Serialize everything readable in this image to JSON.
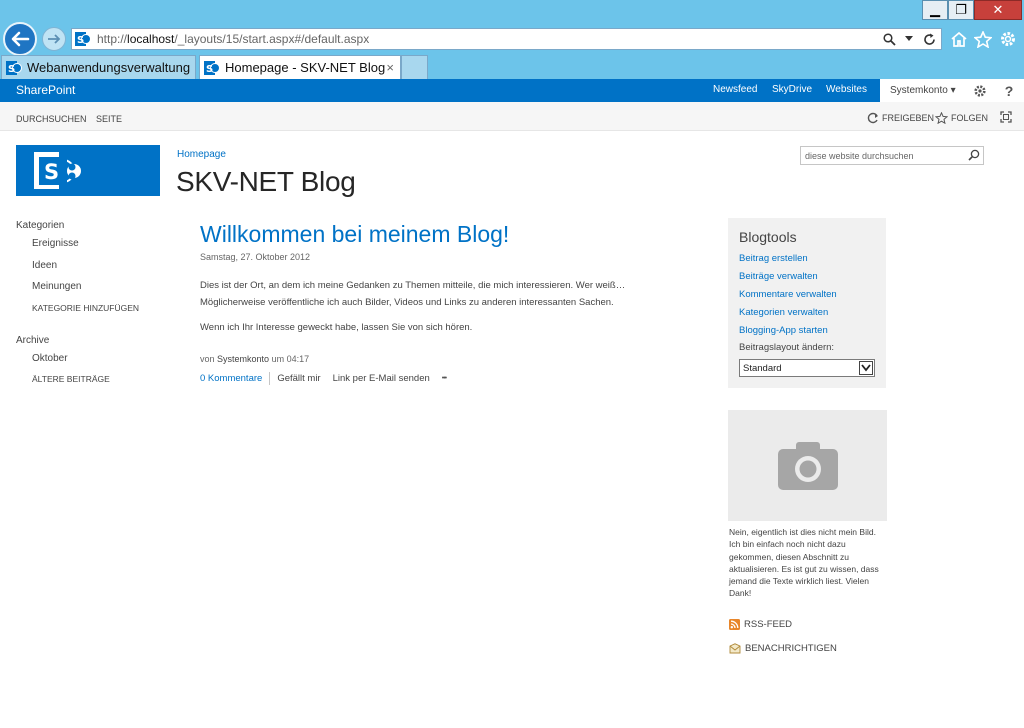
{
  "browser": {
    "window_buttons": {
      "minimize": "▁",
      "maximize": "❐",
      "close": "✕"
    },
    "address": {
      "url_prefix": "http://",
      "url_host": "localhost",
      "url_path": "/_layouts/15/start.aspx#/default.aspx"
    },
    "tabs": [
      {
        "label": "Webanwendungsverwaltung",
        "active": false
      },
      {
        "label": "Homepage - SKV-NET Blog",
        "active": true
      }
    ],
    "tab_close": "×"
  },
  "suitebar": {
    "brand": "SharePoint",
    "links": [
      "Newsfeed",
      "SkyDrive",
      "Websites"
    ],
    "user": "Systemkonto",
    "user_caret": "▾",
    "settings_icon": "gear-icon",
    "help_label": "?"
  },
  "ribbon": {
    "tabs": [
      "DURCHSUCHEN",
      "SEITE"
    ],
    "share_label": "FREIGEBEN",
    "follow_label": "FOLGEN"
  },
  "site": {
    "breadcrumb": "Homepage",
    "title": "SKV-NET Blog",
    "search_placeholder": "diese website durchsuchen"
  },
  "nav": {
    "categories_header": "Kategorien",
    "categories": [
      "Ereignisse",
      "Ideen",
      "Meinungen"
    ],
    "add_category": "KATEGORIE HINZUFÜGEN",
    "archive_header": "Archive",
    "archive_items": [
      "Oktober"
    ],
    "older_posts": "ÄLTERE BEITRÄGE"
  },
  "post": {
    "title": "Willkommen bei meinem Blog!",
    "date": "Samstag, 27. Oktober 2012",
    "paragraph1_line1": "Dies ist der Ort, an dem ich meine Gedanken zu Themen mitteile, die mich interessieren. Wer weiß…",
    "paragraph1_line2": "Möglicherweise veröffentliche ich auch Bilder, Videos und Links zu anderen interessanten Sachen.",
    "paragraph2": "Wenn ich Ihr Interesse geweckt habe, lassen Sie von sich hören.",
    "author_prefix": "von",
    "author": "Systemkonto",
    "author_time": "um 04:17",
    "comments": "0 Kommentare",
    "like": "Gefällt mir",
    "email_link": "Link per E-Mail senden",
    "more": "•••"
  },
  "blogtools": {
    "title": "Blogtools",
    "links": [
      "Beitrag erstellen",
      "Beiträge verwalten",
      "Kommentare verwalten",
      "Kategorien verwalten",
      "Blogging-App starten"
    ],
    "layout_label": "Beitragslayout ändern:",
    "layout_value": "Standard"
  },
  "sidebar_picture": {
    "icon": "camera-icon",
    "caption": "Nein, eigentlich ist dies nicht mein Bild. Ich bin einfach noch nicht dazu gekommen, diesen Abschnitt zu aktualisieren. Es ist gut zu wissen, dass jemand die Texte wirklich liest. Vielen Dank!"
  },
  "feeds": {
    "rss": "RSS-FEED",
    "notify": "BENACHRICHTIGEN"
  },
  "colors": {
    "sp_blue": "#0072c6",
    "chrome_bg": "#6cc4ea",
    "panel_bg": "#f1f1f1"
  }
}
